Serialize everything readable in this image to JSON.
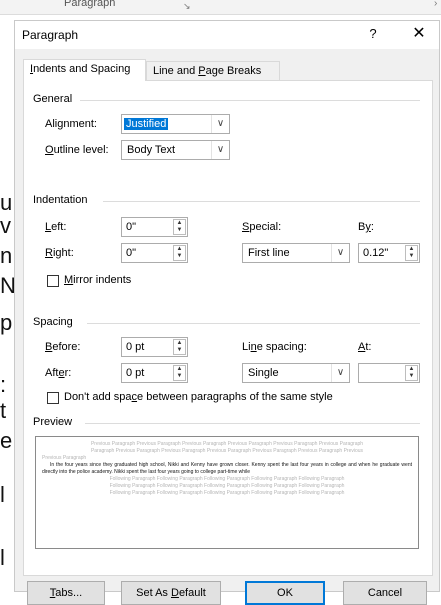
{
  "background": {
    "ribbon_label": "Paragraph",
    "letters": [
      "u",
      "v",
      "n",
      "N",
      "p",
      ":",
      "t",
      "e",
      "l",
      "l"
    ]
  },
  "dialog": {
    "title": "Paragraph",
    "help": "?",
    "close": "✕",
    "tabs": [
      {
        "label_pre": "",
        "mnemonic": "I",
        "label_post": "ndents and Spacing",
        "active": true
      },
      {
        "label_pre": "Line and ",
        "mnemonic": "P",
        "label_post": "age Breaks",
        "active": false
      }
    ]
  },
  "general": {
    "heading": "General",
    "alignment_label_pre": "Ali",
    "alignment_label_mn": "g",
    "alignment_label_post": "nment:",
    "alignment_value": "Justified",
    "outline_label_pre": "",
    "outline_label_mn": "O",
    "outline_label_post": "utline level:",
    "outline_value": "Body Text"
  },
  "indentation": {
    "heading": "Indentation",
    "left_label_pre": "",
    "left_label_mn": "L",
    "left_label_post": "eft:",
    "left_value": "0\"",
    "right_label_pre": "",
    "right_label_mn": "R",
    "right_label_post": "ight:",
    "right_value": "0\"",
    "special_label_pre": "",
    "special_label_mn": "S",
    "special_label_post": "pecial:",
    "special_value": "First line",
    "by_label_pre": "B",
    "by_label_mn": "y",
    "by_label_post": ":",
    "by_value": "0.12\"",
    "mirror_label_pre": "",
    "mirror_label_mn": "M",
    "mirror_label_post": "irror indents",
    "mirror_checked": false
  },
  "spacing": {
    "heading": "Spacing",
    "before_label_pre": "",
    "before_label_mn": "B",
    "before_label_post": "efore:",
    "before_value": "0 pt",
    "after_label_pre": "Aft",
    "after_label_mn": "e",
    "after_label_post": "r:",
    "after_value": "0 pt",
    "line_spacing_label_pre": "Li",
    "line_spacing_label_mn": "n",
    "line_spacing_label_post": "e spacing:",
    "line_spacing_value": "Single",
    "at_label_pre": "",
    "at_label_mn": "A",
    "at_label_post": "t:",
    "at_value": "",
    "dont_add_label_pre": "Don't add spa",
    "dont_add_label_mn": "c",
    "dont_add_label_post": "e between paragraphs of the same style",
    "dont_add_checked": false
  },
  "preview": {
    "heading": "Preview",
    "previous_lines": [
      "Previous Paragraph Previous Paragraph Previous Paragraph Previous Paragraph Previous Paragraph Previous Paragraph",
      "Paragraph Previous Paragraph Previous Paragraph Previous Paragraph Previous Paragraph Previous Paragraph Previous",
      "Previous Paragraph"
    ],
    "sample_text": "In the four years since they graduated high school, Nikki and Kenny have grown closer. Kenny spent the last four years in college and when he graduate went directly into the police academy. Nikki spent the last four years going to college part-time while",
    "following_lines": [
      "Following Paragraph Following Paragraph Following Paragraph Following Paragraph Following Paragraph",
      "Following Paragraph Following Paragraph Following Paragraph Following Paragraph Following Paragraph",
      "Following Paragraph Following Paragraph Following Paragraph Following Paragraph Following Paragraph"
    ]
  },
  "buttons": {
    "tabs_pre": "",
    "tabs_mn": "T",
    "tabs_post": "abs...",
    "default_pre": "Set As ",
    "default_mn": "D",
    "default_post": "efault",
    "ok": "OK",
    "cancel": "Cancel"
  },
  "colors": {
    "accent": "#0078d7",
    "dialog_bg": "#f0f0f0",
    "panel_bg": "#ffffff"
  }
}
